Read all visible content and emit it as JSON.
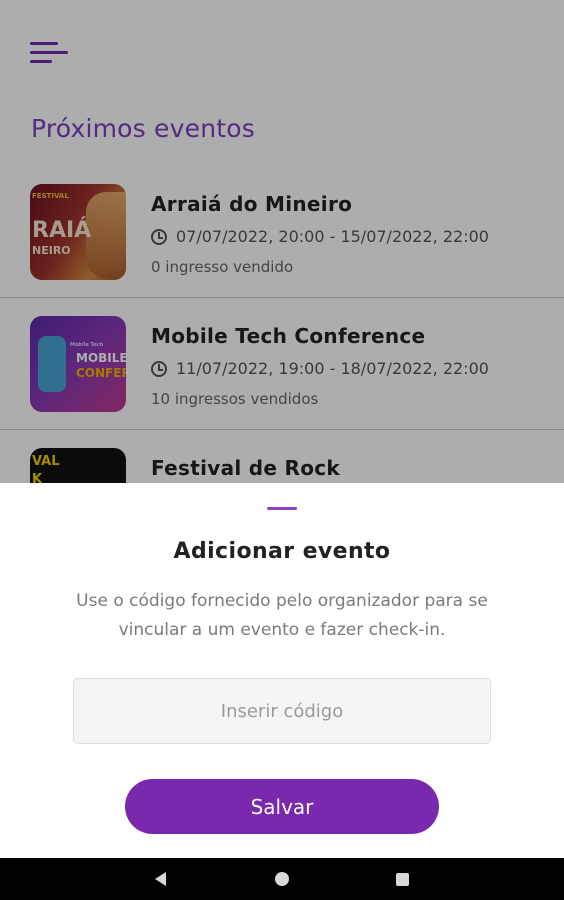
{
  "header": {
    "menu_icon": "hamburger-menu-icon",
    "section_title": "Próximos eventos"
  },
  "events": [
    {
      "title": "Arraiá do Mineiro",
      "datetime": "07/07/2022, 20:00 - 15/07/2022, 22:00",
      "tickets_sold": "0 ingresso vendido",
      "thumb_text": [
        "RAIÁ",
        "NEIRO",
        "FESTIVAL"
      ]
    },
    {
      "title": "Mobile Tech Conference",
      "datetime": "11/07/2022, 19:00 - 18/07/2022, 22:00",
      "tickets_sold": "10 ingressos vendidos",
      "thumb_text": [
        "MOBILE T",
        "CONFER",
        "Mobile Tech"
      ]
    },
    {
      "title": "Festival de Rock",
      "thumb_text": [
        "VAL",
        "K"
      ]
    }
  ],
  "sheet": {
    "title": "Adicionar evento",
    "description": "Use o código fornecido pelo organizador para se vincular a um evento e fazer check-in.",
    "input_value": "",
    "input_placeholder": "Inserir código",
    "save_label": "Salvar"
  },
  "navbar": {
    "icons": [
      "back-icon",
      "home-icon",
      "recents-icon"
    ]
  },
  "colors": {
    "accent": "#7a28ad",
    "section_title": "#7d3fc0",
    "handle": "#8b3fc7",
    "navbar": "#000000"
  }
}
